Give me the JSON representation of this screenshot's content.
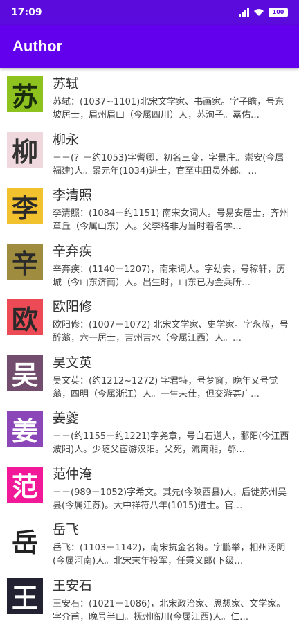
{
  "status": {
    "time": "17:09",
    "battery": "100"
  },
  "app_bar": {
    "title": "Author"
  },
  "authors": [
    {
      "name": "苏轼",
      "glyph": "苏",
      "bg": "#8dc21f",
      "fg": "#1a2c0e",
      "desc": "苏轼：(1037~1101)北宋文学家、书画家。字子瞻，号东坡居士，眉州眉山（今属四川）人，苏洵子。嘉佑…"
    },
    {
      "name": "柳永",
      "glyph": "柳",
      "bg": "#efd9de",
      "fg": "#333333",
      "desc": "－－(？－约1053)字耆卿，初名三变，字景庄。崇安(今属福建)人。景元年(1034)进士，官至屯田员外郎。…"
    },
    {
      "name": "李清照",
      "glyph": "李",
      "bg": "#f2c12e",
      "fg": "#2a2a2a",
      "desc": "李清照：(1084－约1151) 南宋女词人。号易安居士，齐州章丘（今属山东）人。父李格非为当时着名学…"
    },
    {
      "name": "辛弃疾",
      "glyph": "辛",
      "bg": "#a08c3e",
      "fg": "#2a2a2a",
      "desc": "辛弃疾：(1140－1207)，南宋词人。字幼安，号稼轩，历城（今山东济南）人。出生时，山东已为金兵所…"
    },
    {
      "name": "欧阳修",
      "glyph": "欧",
      "bg": "#ec4a55",
      "fg": "#2a2a2a",
      "desc": "欧阳修：(1007－1072) 北宋文学家、史学家。字永叔，号醉翁，六一居士，吉州吉水（今属江西）人。…"
    },
    {
      "name": "吴文英",
      "glyph": "吴",
      "bg": "#734d6e",
      "fg": "#ffffff",
      "desc": "吴文英：(约1212~1272) 字君特，号梦窗，晚年又号觉翁，四明（今属浙江）人。一生未仕，但交游甚广…"
    },
    {
      "name": "姜夔",
      "glyph": "姜",
      "bg": "#8b47b8",
      "fg": "#ffffff",
      "desc": "－－(约1155－约1221)字尧章，号白石道人，鄱阳(今江西波阳)人。少随父宦游汉阳。父死，流寓湘，鄂…"
    },
    {
      "name": "范仲淹",
      "glyph": "范",
      "bg": "#f21998",
      "fg": "#ffffff",
      "desc": "－－(989－1052)字希文。其先(今陕西县)人，后徙苏州吴县(今属江苏)。大中祥符八年(1015)进士。官…"
    },
    {
      "name": "岳飞",
      "glyph": "岳",
      "bg": "#ffffff",
      "fg": "#222222",
      "desc": "岳飞：(1103－1142)，南宋抗金名将。字鹏举，相州汤阴(今属河南)人。北宋末年投军，任秉义郎(下级…"
    },
    {
      "name": "王安石",
      "glyph": "王",
      "bg": "#222233",
      "fg": "#ffffff",
      "desc": "王安石：(1021－1086)，北宋政治家、思想家、文学家。字介甫，晚号半山。抚州临川(今属江西)人。仁…"
    }
  ]
}
